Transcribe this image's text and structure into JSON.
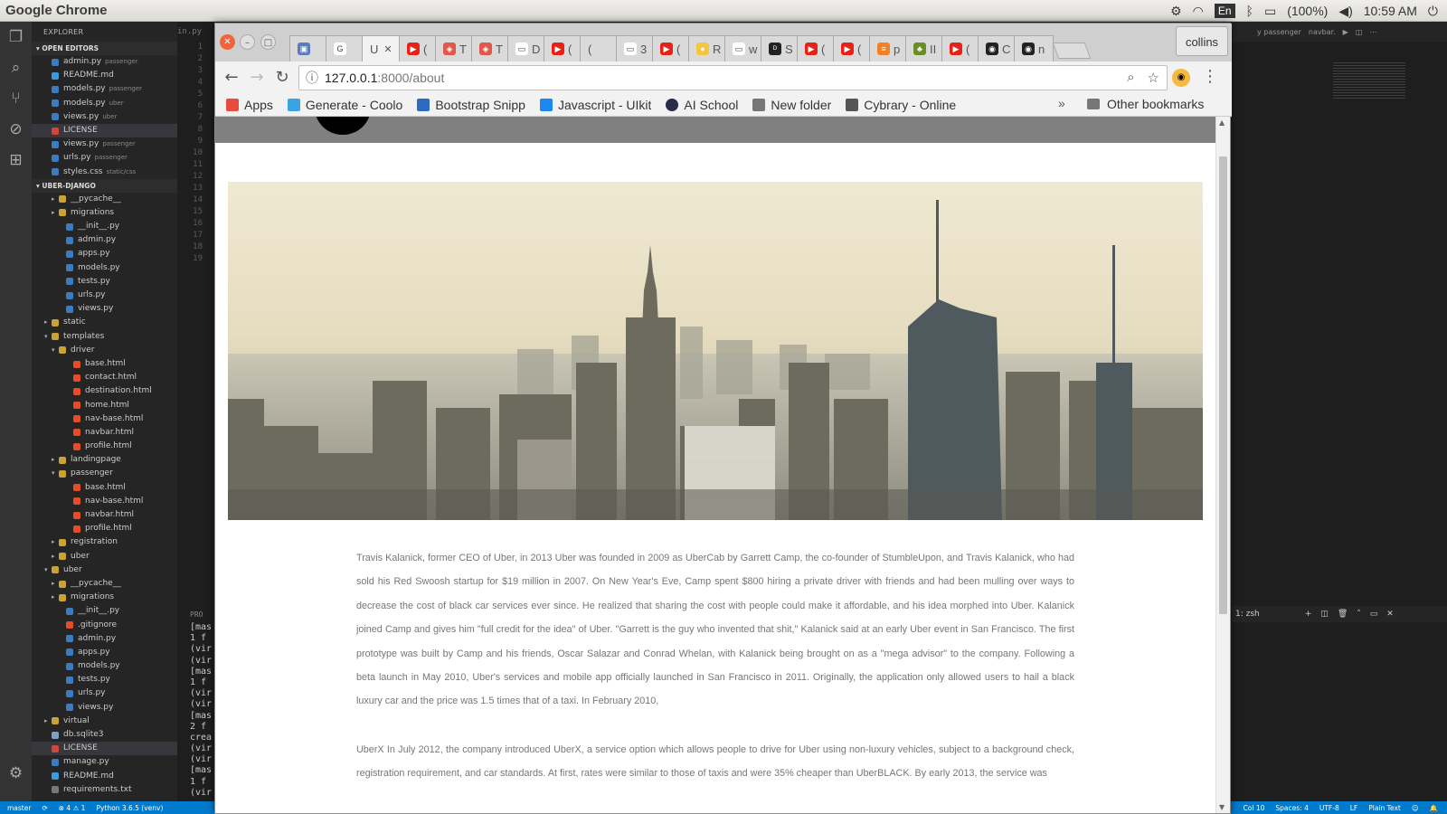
{
  "system": {
    "app_name": "Google Chrome",
    "keyboard": "En",
    "battery": "(100%)",
    "time": "10:59 AM"
  },
  "vscode": {
    "explorer_title": "EXPLORER",
    "open_editors_title": "OPEN EDITORS",
    "open_editors": [
      {
        "name": "admin.py",
        "sub": "passenger",
        "type": "py"
      },
      {
        "name": "README.md",
        "sub": "",
        "type": "md"
      },
      {
        "name": "models.py",
        "sub": "passenger",
        "type": "py"
      },
      {
        "name": "models.py",
        "sub": "uber",
        "type": "py"
      },
      {
        "name": "views.py",
        "sub": "uber",
        "type": "py"
      },
      {
        "name": "LICENSE",
        "sub": "",
        "type": "lic"
      },
      {
        "name": "views.py",
        "sub": "passenger",
        "type": "py"
      },
      {
        "name": "urls.py",
        "sub": "passenger",
        "type": "py"
      },
      {
        "name": "styles.css",
        "sub": "static/css",
        "type": "css"
      }
    ],
    "project_title": "UBER-DJANGO",
    "tree": [
      {
        "name": "__pycache__",
        "indent": 2,
        "type": "fold",
        "arrow": "▸"
      },
      {
        "name": "migrations",
        "indent": 2,
        "type": "fold",
        "arrow": "▸"
      },
      {
        "name": "__init__.py",
        "indent": 3,
        "type": "py",
        "arrow": ""
      },
      {
        "name": "admin.py",
        "indent": 3,
        "type": "py",
        "arrow": ""
      },
      {
        "name": "apps.py",
        "indent": 3,
        "type": "py",
        "arrow": ""
      },
      {
        "name": "models.py",
        "indent": 3,
        "type": "py",
        "arrow": ""
      },
      {
        "name": "tests.py",
        "indent": 3,
        "type": "py",
        "arrow": ""
      },
      {
        "name": "urls.py",
        "indent": 3,
        "type": "py",
        "arrow": ""
      },
      {
        "name": "views.py",
        "indent": 3,
        "type": "py",
        "arrow": ""
      },
      {
        "name": "static",
        "indent": 1,
        "type": "fold",
        "arrow": "▸"
      },
      {
        "name": "templates",
        "indent": 1,
        "type": "fold",
        "arrow": "▾"
      },
      {
        "name": "driver",
        "indent": 2,
        "type": "fold",
        "arrow": "▾"
      },
      {
        "name": "base.html",
        "indent": 4,
        "type": "html",
        "arrow": ""
      },
      {
        "name": "contact.html",
        "indent": 4,
        "type": "html",
        "arrow": ""
      },
      {
        "name": "destination.html",
        "indent": 4,
        "type": "html",
        "arrow": ""
      },
      {
        "name": "home.html",
        "indent": 4,
        "type": "html",
        "arrow": ""
      },
      {
        "name": "nav-base.html",
        "indent": 4,
        "type": "html",
        "arrow": ""
      },
      {
        "name": "navbar.html",
        "indent": 4,
        "type": "html",
        "arrow": ""
      },
      {
        "name": "profile.html",
        "indent": 4,
        "type": "html",
        "arrow": ""
      },
      {
        "name": "landingpage",
        "indent": 2,
        "type": "fold",
        "arrow": "▸"
      },
      {
        "name": "passenger",
        "indent": 2,
        "type": "fold",
        "arrow": "▾"
      },
      {
        "name": "base.html",
        "indent": 4,
        "type": "html",
        "arrow": ""
      },
      {
        "name": "nav-base.html",
        "indent": 4,
        "type": "html",
        "arrow": ""
      },
      {
        "name": "navbar.html",
        "indent": 4,
        "type": "html",
        "arrow": ""
      },
      {
        "name": "profile.html",
        "indent": 4,
        "type": "html",
        "arrow": ""
      },
      {
        "name": "registration",
        "indent": 2,
        "type": "fold",
        "arrow": "▸"
      },
      {
        "name": "uber",
        "indent": 2,
        "type": "fold",
        "arrow": "▸"
      },
      {
        "name": "uber",
        "indent": 1,
        "type": "fold",
        "arrow": "▾"
      },
      {
        "name": "__pycache__",
        "indent": 2,
        "type": "fold",
        "arrow": "▸"
      },
      {
        "name": "migrations",
        "indent": 2,
        "type": "fold",
        "arrow": "▸"
      },
      {
        "name": "__init__.py",
        "indent": 3,
        "type": "py",
        "arrow": ""
      },
      {
        "name": ".gitignore",
        "indent": 3,
        "type": "git",
        "arrow": ""
      },
      {
        "name": "admin.py",
        "indent": 3,
        "type": "py",
        "arrow": ""
      },
      {
        "name": "apps.py",
        "indent": 3,
        "type": "py",
        "arrow": ""
      },
      {
        "name": "models.py",
        "indent": 3,
        "type": "py",
        "arrow": ""
      },
      {
        "name": "tests.py",
        "indent": 3,
        "type": "py",
        "arrow": ""
      },
      {
        "name": "urls.py",
        "indent": 3,
        "type": "py",
        "arrow": ""
      },
      {
        "name": "views.py",
        "indent": 3,
        "type": "py",
        "arrow": ""
      },
      {
        "name": "virtual",
        "indent": 1,
        "type": "fold",
        "arrow": "▸"
      },
      {
        "name": "db.sqlite3",
        "indent": 1,
        "type": "db",
        "arrow": ""
      },
      {
        "name": "LICENSE",
        "indent": 1,
        "type": "lic",
        "arrow": ""
      },
      {
        "name": "manage.py",
        "indent": 1,
        "type": "py",
        "arrow": ""
      },
      {
        "name": "README.md",
        "indent": 1,
        "type": "md",
        "arrow": ""
      },
      {
        "name": "requirements.txt",
        "indent": 1,
        "type": "txt",
        "arrow": ""
      }
    ],
    "editor_tab": "in.py",
    "line_numbers": [
      "1",
      "2",
      "3",
      "4",
      "5",
      "6",
      "7",
      "8",
      "9",
      "10",
      "11",
      "12",
      "13",
      "14",
      "15",
      "16",
      "17",
      "18",
      "19"
    ],
    "panel_label": "PRO",
    "terminal_lines": [
      "[mas",
      "1 f",
      "(vir",
      "(vir",
      "[mas",
      "1 f",
      "(vir",
      "(vir",
      "[mas",
      "2 f",
      "crea",
      "(vir",
      "(vir",
      "[mas",
      "1 f",
      "(vir"
    ],
    "right_tabs": [
      "y passenger",
      "navbar."
    ],
    "right_terminal": "1: zsh",
    "status": {
      "branch": "master",
      "problems": "⊗ 4 ⚠ 1",
      "python": "Python 3.6.5 (venv)",
      "col": "Col 10",
      "spaces": "Spaces: 4",
      "encoding": "UTF-8",
      "eol": "LF",
      "lang": "Plain Text"
    }
  },
  "chrome": {
    "tabs": [
      {
        "label": "",
        "color": "#5b7bbf",
        "glyph": "▣"
      },
      {
        "label": "",
        "color": "#ffffff",
        "glyph": "G"
      },
      {
        "label": "U",
        "color": "",
        "glyph": ""
      },
      {
        "label": "(",
        "color": "#e62117",
        "glyph": "▶"
      },
      {
        "label": "T",
        "color": "#e0584a",
        "glyph": "◈"
      },
      {
        "label": "T",
        "color": "#e0584a",
        "glyph": "◈"
      },
      {
        "label": "D",
        "color": "#ffffff",
        "glyph": "▭"
      },
      {
        "label": "(",
        "color": "#e62117",
        "glyph": "▶"
      },
      {
        "label": "(",
        "color": "",
        "glyph": ""
      },
      {
        "label": "3",
        "color": "#ffffff",
        "glyph": "▭"
      },
      {
        "label": "(",
        "color": "#e62117",
        "glyph": "▶"
      },
      {
        "label": "R",
        "color": "#f5c542",
        "glyph": "●"
      },
      {
        "label": "w",
        "color": "#ffffff",
        "glyph": "▭"
      },
      {
        "label": "S",
        "color": "#222222",
        "glyph": "ᴰ"
      },
      {
        "label": "(",
        "color": "#e62117",
        "glyph": "▶"
      },
      {
        "label": "(",
        "color": "#e62117",
        "glyph": "▶"
      },
      {
        "label": "p",
        "color": "#f48024",
        "glyph": "≡"
      },
      {
        "label": "II",
        "color": "#6b8e23",
        "glyph": "♣"
      },
      {
        "label": "(",
        "color": "#e62117",
        "glyph": "▶"
      },
      {
        "label": "C",
        "color": "#222222",
        "glyph": "◉"
      },
      {
        "label": "n",
        "color": "#222222",
        "glyph": "◉"
      }
    ],
    "profile_name": "collins",
    "url_host": "127.0.0.1",
    "url_path": ":8000/about",
    "bookmarks": [
      {
        "label": "Apps",
        "color": "#e84c3d"
      },
      {
        "label": "Generate - Coolo",
        "color": "#3aa3e3"
      },
      {
        "label": "Bootstrap Snipp",
        "color": "#2d6ac2"
      },
      {
        "label": "Javascript - UIkit",
        "color": "#1e87f0"
      },
      {
        "label": "AI School",
        "color": "#2a2a4a"
      },
      {
        "label": "New folder",
        "color": "#777777"
      },
      {
        "label": "Cybrary - Online",
        "color": "#555555"
      }
    ],
    "bookmarks_overflow": "»",
    "other_bookmarks": "Other bookmarks"
  },
  "page": {
    "paragraphs": [
      "Travis Kalanick, former CEO of Uber, in 2013 Uber was founded in 2009 as UberCab by Garrett Camp, the co-founder of StumbleUpon, and Travis Kalanick, who had sold his Red Swoosh startup for $19 million in 2007. On New Year's Eve, Camp spent $800 hiring a private driver with friends and had been mulling over ways to decrease the cost of black car services ever since. He realized that sharing the cost with people could make it affordable, and his idea morphed into Uber. Kalanick joined Camp and gives him \"full credit for the idea\" of Uber. \"Garrett is the guy who invented that shit,\" Kalanick said at an early Uber event in San Francisco. The first prototype was built by Camp and his friends, Oscar Salazar and Conrad Whelan, with Kalanick being brought on as a \"mega advisor\" to the company. Following a beta launch in May 2010, Uber's services and mobile app officially launched in San Francisco in 2011. Originally, the application only allowed users to hail a black luxury car and the price was 1.5 times that of a taxi. In February 2010,",
      "UberX In July 2012, the company introduced UberX, a service option which allows people to drive for Uber using non-luxury vehicles, subject to a background check, registration requirement, and car standards. At first, rates were similar to those of taxis and were 35% cheaper than UberBLACK. By early 2013, the service was"
    ]
  }
}
